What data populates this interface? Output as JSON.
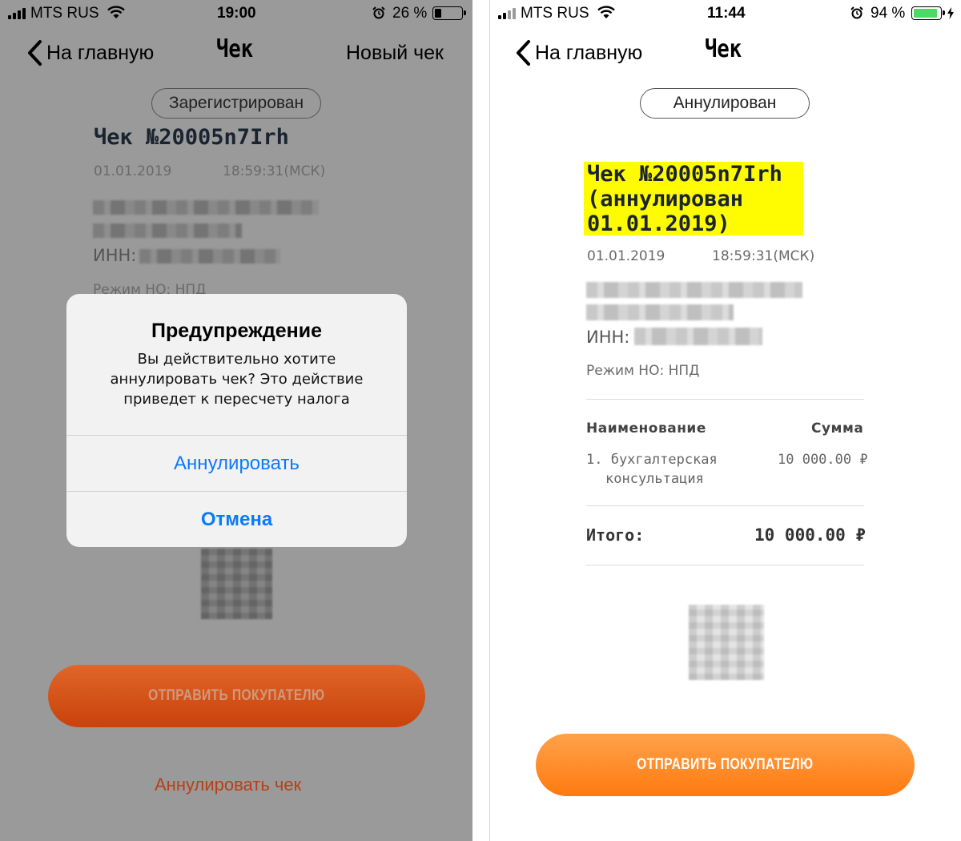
{
  "left": {
    "status": {
      "carrier": "MTS RUS",
      "time": "19:00",
      "battery": "26 %",
      "battery_level": 0.26
    },
    "nav": {
      "back_label": "На главную",
      "title": "Чек",
      "right_label": "Новый чек"
    },
    "status_pill": "Зарегистрирован",
    "check_title": "Чек №20005n7Irh",
    "date": "01.01.2019",
    "time": "18:59:31(МСК)",
    "inn_label": "ИНН:",
    "regime": "Режим НО: НПД",
    "alert": {
      "title": "Предупреждение",
      "message": "Вы действительно хотите аннулировать чек? Это действие приведет к пересчету налога",
      "confirm": "Аннулировать",
      "cancel": "Отмена"
    },
    "send_button": "ОТПРАВИТЬ ПОКУПАТЕЛЮ",
    "annul_link": "Аннулировать чек"
  },
  "right": {
    "status": {
      "carrier": "MTS RUS",
      "time": "11:44",
      "battery": "94 %",
      "battery_level": 0.94
    },
    "nav": {
      "back_label": "На главную",
      "title": "Чек"
    },
    "status_pill": "Аннулирован",
    "check_title_lines": [
      "Чек №20005n7Irh",
      "(аннулирован",
      "01.01.2019)"
    ],
    "date": "01.01.2019",
    "time": "18:59:31(МСК)",
    "inn_label": "ИНН:",
    "regime": "Режим НО: НПД",
    "table": {
      "col_name": "Наименование",
      "col_sum": "Сумма",
      "item_lines": [
        "1. бухгалтерская",
        "консультация"
      ],
      "item_sum": "10 000.00 ₽",
      "total_label": "Итого:",
      "total_value": "10 000.00 ₽"
    },
    "send_button": "ОТПРАВИТЬ ПОКУПАТЕЛЮ"
  },
  "colors": {
    "accent_orange": "#ff8a1f",
    "ios_blue": "#0a7aff",
    "highlight": "#fffb00",
    "battery_green": "#4cd964"
  }
}
